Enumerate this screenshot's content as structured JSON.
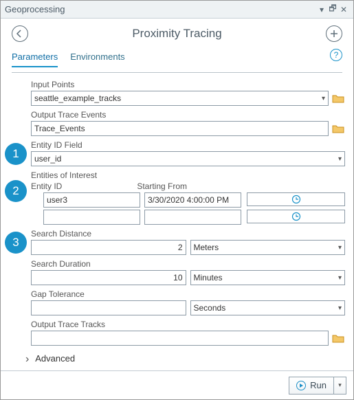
{
  "window": {
    "title": "Geoprocessing"
  },
  "toolbar": {
    "title": "Proximity Tracing"
  },
  "tabs": {
    "active": "Parameters",
    "other": "Environments"
  },
  "callouts": [
    "1",
    "2",
    "3"
  ],
  "fields": {
    "inputPoints": {
      "label": "Input Points",
      "value": "seattle_example_tracks"
    },
    "outputTraceEvents": {
      "label": "Output Trace Events",
      "value": "Trace_Events"
    },
    "entityIdField": {
      "label": "Entity ID Field",
      "value": "user_id"
    },
    "entitiesOfInterest": {
      "label": "Entities of Interest",
      "entityId": {
        "label": "Entity ID",
        "rows": [
          "user3",
          ""
        ]
      },
      "startingFrom": {
        "label": "Starting From",
        "rows": [
          "3/30/2020 4:00:00 PM",
          ""
        ]
      }
    },
    "searchDistance": {
      "label": "Search Distance",
      "value": "2",
      "unit": "Meters"
    },
    "searchDuration": {
      "label": "Search Duration",
      "value": "10",
      "unit": "Minutes"
    },
    "gapTolerance": {
      "label": "Gap Tolerance",
      "value": "",
      "unit": "Seconds"
    },
    "outputTraceTracks": {
      "label": "Output Trace Tracks",
      "value": ""
    }
  },
  "advanced": {
    "label": "Advanced"
  },
  "footer": {
    "run": "Run"
  }
}
